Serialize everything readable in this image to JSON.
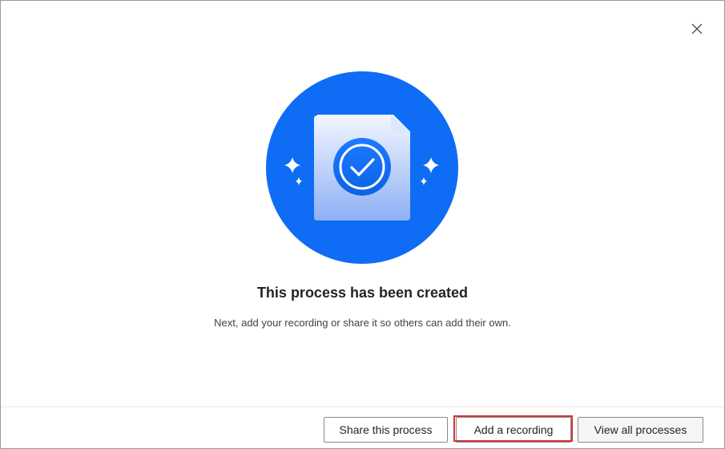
{
  "dialog": {
    "title": "This process has been created",
    "subtitle": "Next, add your recording or share it so others can add their own.",
    "close_icon": "close-icon",
    "illustration_icon": "document-checkmark-icon"
  },
  "footer": {
    "share_label": "Share this process",
    "record_label": "Add a recording",
    "view_label": "View all processes"
  },
  "colors": {
    "accent": "#0f6cf5",
    "highlight": "#d13438"
  }
}
